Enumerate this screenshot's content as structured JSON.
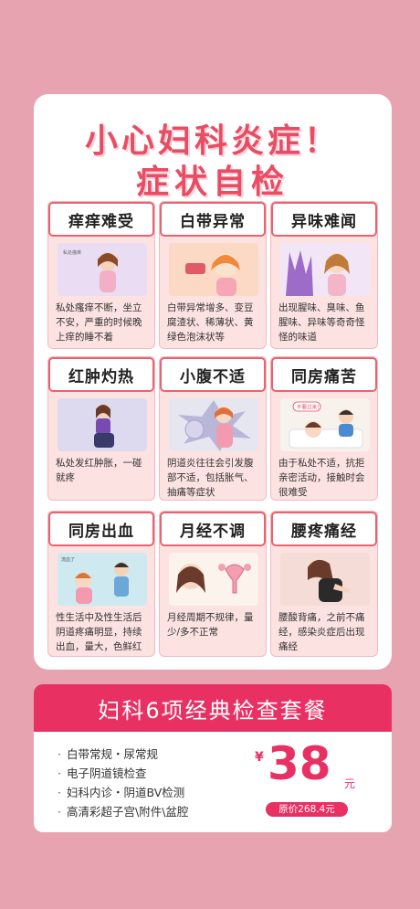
{
  "title": {
    "line1": "小心妇科炎症！",
    "line2": "症状自检"
  },
  "symptoms": [
    {
      "title": "痒痒难受",
      "text": "私处瘙痒不断，坐立不安，严重的时候晚上痒的睡不着",
      "icon": "itchy-woman-illustration",
      "img_caption": "私处瘙痒"
    },
    {
      "title": "白带异常",
      "text": "白带异常增多、变豆腐渣状、稀薄状、黄绿色泡沫状等",
      "icon": "discharge-woman-illustration"
    },
    {
      "title": "异味难闻",
      "text": "出现腥味、臭味、鱼腥味、异味等奇奇怪怪的味道",
      "icon": "odor-woman-illustration"
    },
    {
      "title": "红肿灼热",
      "text": "私处发红肿胀，一碰就疼",
      "icon": "swelling-woman-illustration"
    },
    {
      "title": "小腹不适",
      "text": "阴道炎往往会引发腹部不适，包括胀气、抽痛等症状",
      "icon": "abdomen-pain-illustration"
    },
    {
      "title": "同房痛苦",
      "text": "由于私处不适，抗拒亲密活动，接触时会很难受",
      "icon": "couple-pain-illustration",
      "img_caption": "不要过来！"
    },
    {
      "title": "同房出血",
      "text": "性生活中及性生活后阴道疼痛明显，持续出血，量大，色鲜红",
      "icon": "couple-bleeding-illustration",
      "img_caption": "流血了"
    },
    {
      "title": "月经不调",
      "text": "月经周期不规律，量少/多不正常",
      "icon": "menstruation-illustration"
    },
    {
      "title": "腰疼痛经",
      "text": "腰酸背痛，之前不痛经，感染炎症后出现痛经",
      "icon": "back-pain-illustration"
    }
  ],
  "package": {
    "title": "妇科6项经典检查套餐",
    "items": [
      "白带常规・尿常规",
      "电子阴道镜检查",
      "妇科内诊・阴道BV检测",
      "高清彩超子宫\\附件\\盆腔"
    ],
    "bullet": "·",
    "price_symbol": "¥",
    "price": "38",
    "price_unit": "元",
    "original_price": "原价268.4元"
  },
  "colors": {
    "background": "#e8a3b0",
    "accent": "#e83063",
    "title": "#e84d63",
    "cell_bg": "#fde2e2",
    "cell_border": "#e8636f"
  }
}
